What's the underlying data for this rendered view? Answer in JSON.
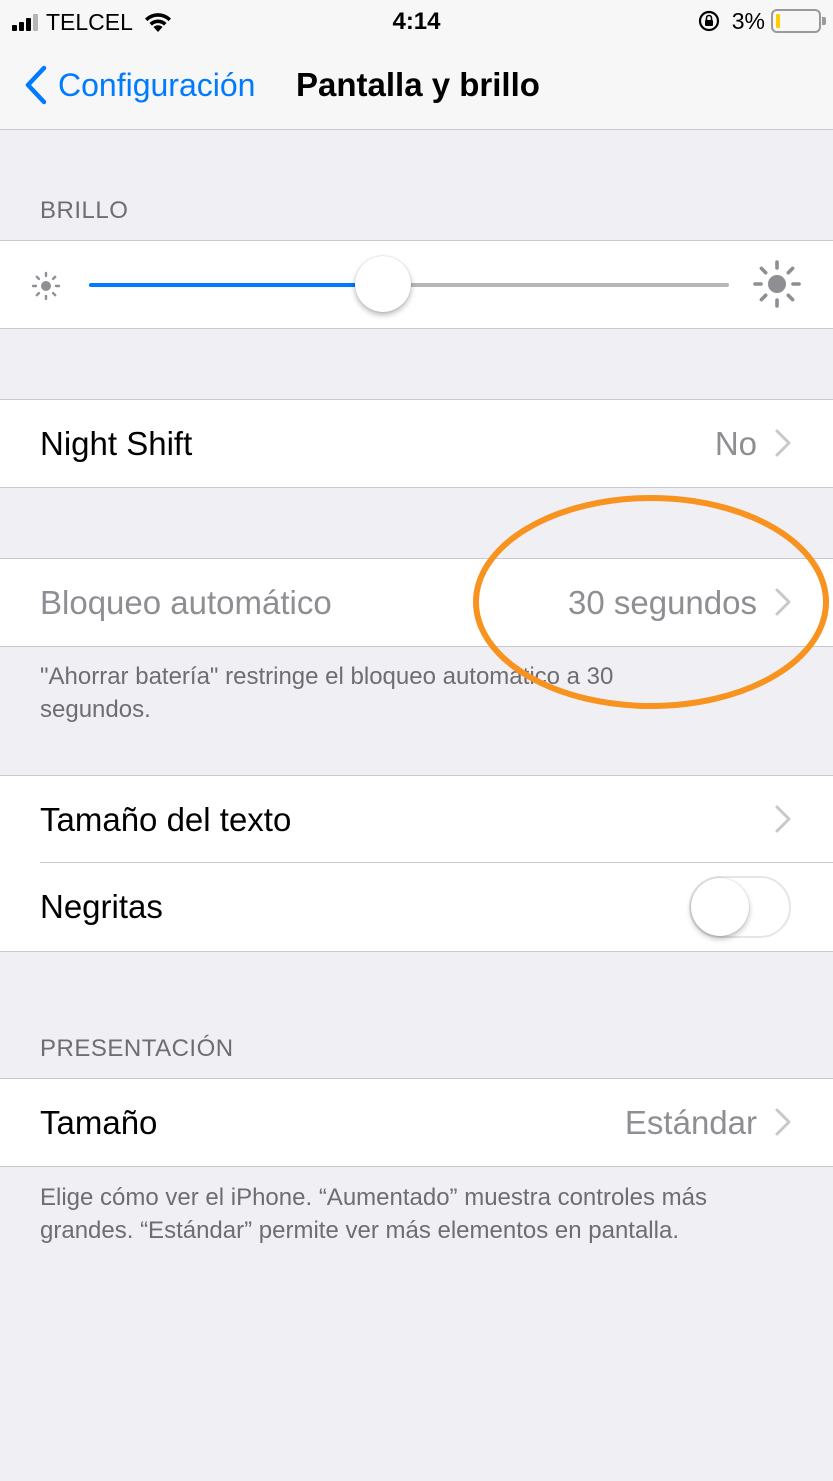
{
  "status_bar": {
    "carrier": "TELCEL",
    "time": "4:14",
    "battery_percent": "3%",
    "battery_level": 0.03,
    "icons": [
      "signal-icon",
      "wifi-icon",
      "orientation-lock-icon",
      "battery-icon"
    ]
  },
  "nav": {
    "back_label": "Configuración",
    "title": "Pantalla y brillo"
  },
  "brightness": {
    "header": "BRILLO",
    "level": 0.46,
    "accent_color": "#007aff"
  },
  "night_shift": {
    "label": "Night Shift",
    "value": "No"
  },
  "auto_lock": {
    "label": "Bloqueo automático",
    "value": "30 segundos",
    "footer": "\"Ahorrar batería\" restringe el bloqueo automático a 30 segundos.",
    "highlight_color": "#f7931e"
  },
  "text": {
    "size_label": "Tamaño del texto",
    "bold_label": "Negritas",
    "bold_on": false
  },
  "display_zoom": {
    "header": "PRESENTACIÓN",
    "label": "Tamaño",
    "value": "Estándar",
    "footer": "Elige cómo ver el iPhone. “Aumentado” muestra controles más grandes. “Estándar” permite ver más elementos en pantalla."
  }
}
